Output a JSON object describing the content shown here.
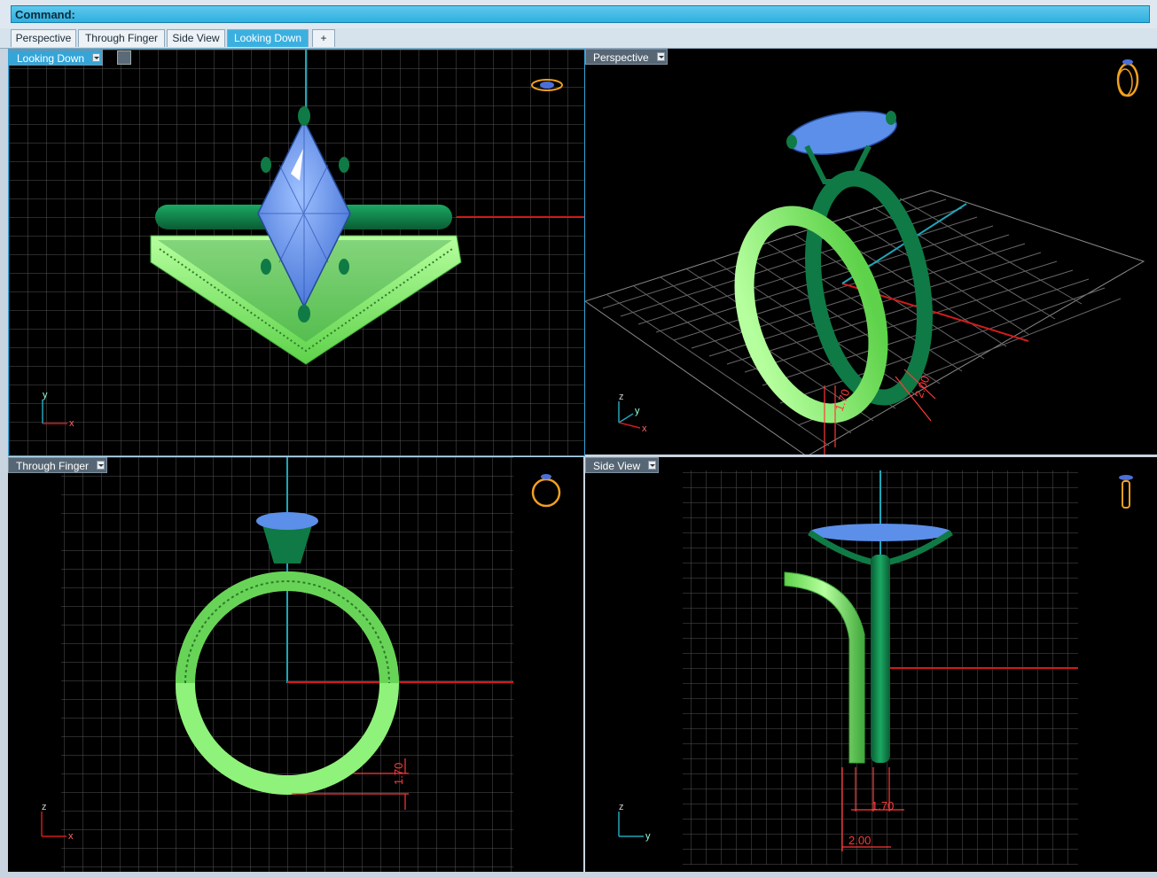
{
  "command": {
    "label": "Command:"
  },
  "tabs": [
    {
      "label": "Perspective"
    },
    {
      "label": "Through Finger"
    },
    {
      "label": "Side View"
    },
    {
      "label": "Looking Down"
    },
    {
      "label": "+"
    }
  ],
  "viewports": {
    "top_left": {
      "label": "Looking Down"
    },
    "top_right": {
      "label": "Perspective"
    },
    "bottom_left": {
      "label": "Through Finger"
    },
    "bottom_right": {
      "label": "Side View"
    }
  },
  "axes": {
    "looking_down": {
      "v": "y",
      "h": "x"
    },
    "perspective": {
      "a": "z",
      "b": "y",
      "c": "x"
    },
    "through_finger": {
      "v": "z",
      "h": "x"
    },
    "side_view": {
      "v": "z",
      "h": "y"
    }
  },
  "dimensions": {
    "through_finger_v": "1.70",
    "side_view_a": "1.70",
    "side_view_b": "2.00",
    "perspective_a": "1.70",
    "perspective_b": "2.00"
  },
  "colors": {
    "accent": "#35a5d8",
    "band_light": "#8ff27a",
    "band_dark": "#0f7a45",
    "gem": "#5b8fea",
    "grid": "#6a6a6a",
    "axis_red": "#d11a1a",
    "axis_cyan": "#1fa5b8",
    "dimension": "#ff3a3a"
  }
}
